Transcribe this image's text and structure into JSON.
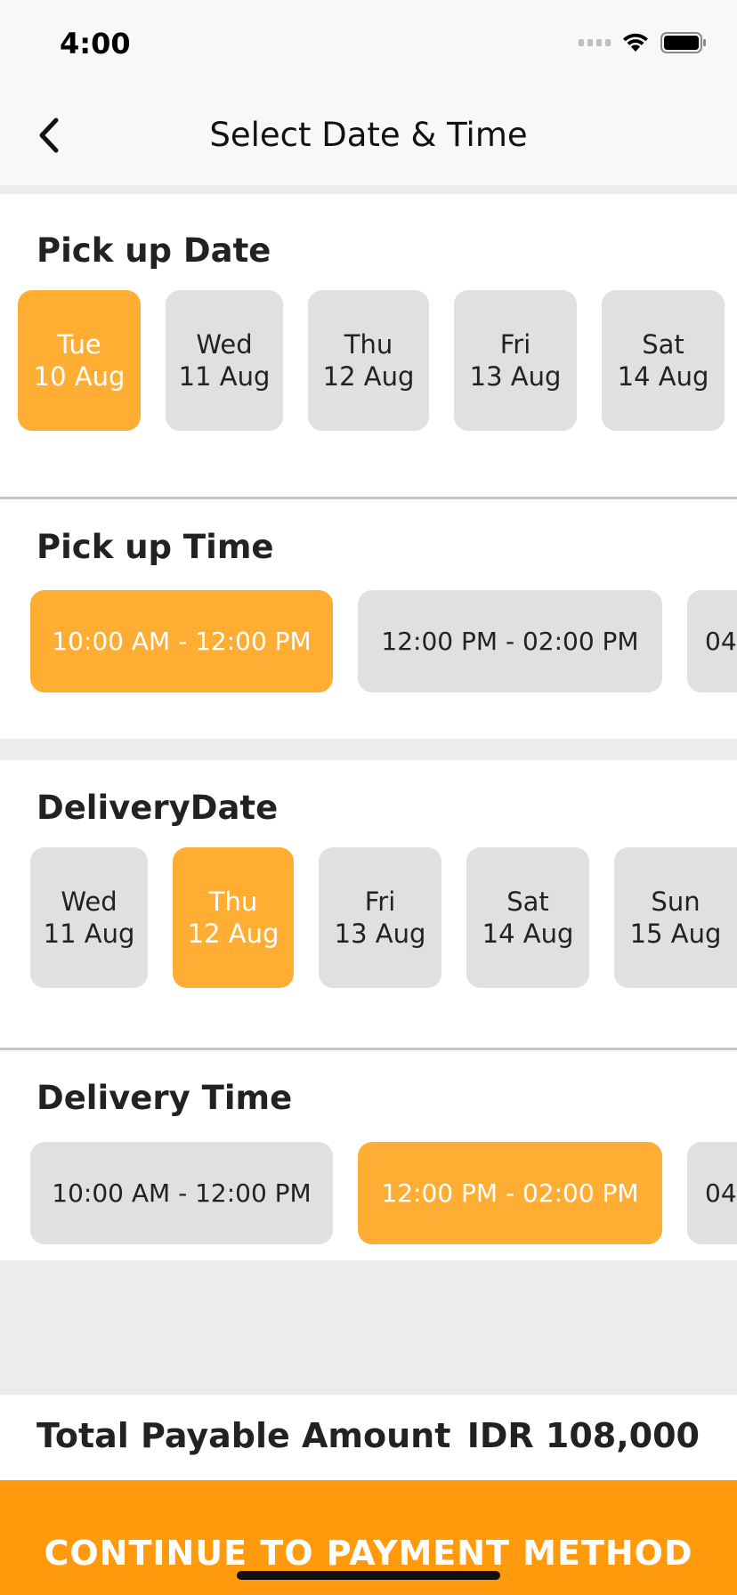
{
  "status_bar": {
    "time": "4:00"
  },
  "nav": {
    "title": "Select Date & Time"
  },
  "pickup_date": {
    "title": "Pick up Date",
    "items": [
      {
        "day": "Tue",
        "date": "10 Aug"
      },
      {
        "day": "Wed",
        "date": "11 Aug"
      },
      {
        "day": "Thu",
        "date": "12 Aug"
      },
      {
        "day": "Fri",
        "date": "13 Aug"
      },
      {
        "day": "Sat",
        "date": "14 Aug"
      }
    ],
    "selected": "Tue 10 Aug"
  },
  "pickup_time": {
    "title": "Pick up Time",
    "items": [
      "10:00 AM - 12:00 PM",
      "12:00 PM - 02:00 PM",
      "04"
    ],
    "selected": "10:00 AM - 12:00 PM"
  },
  "delivery_date": {
    "title": "DeliveryDate",
    "items": [
      {
        "day": "Wed",
        "date": "11 Aug"
      },
      {
        "day": "Thu",
        "date": "12 Aug"
      },
      {
        "day": "Fri",
        "date": "13 Aug"
      },
      {
        "day": "Sat",
        "date": "14 Aug"
      },
      {
        "day": "Sun",
        "date": "15 Aug"
      }
    ],
    "selected": "Thu 12 Aug"
  },
  "delivery_time": {
    "title": "Delivery Time",
    "items": [
      "10:00 AM - 12:00 PM",
      "12:00 PM - 02:00 PM",
      "04"
    ],
    "selected": "12:00 PM - 02:00 PM"
  },
  "total": {
    "label": "Total Payable Amount",
    "value": "IDR 108,000"
  },
  "continue_button": {
    "label": "CONTINUE TO PAYMENT METHOD"
  },
  "colors": {
    "accent": "#ffad33",
    "button": "#ff9a0d",
    "chip": "#e0e0e0"
  },
  "icons": {
    "back": "chevron-left-icon",
    "wifi": "wifi-icon",
    "battery": "battery-icon",
    "signal": "signal-icon"
  }
}
